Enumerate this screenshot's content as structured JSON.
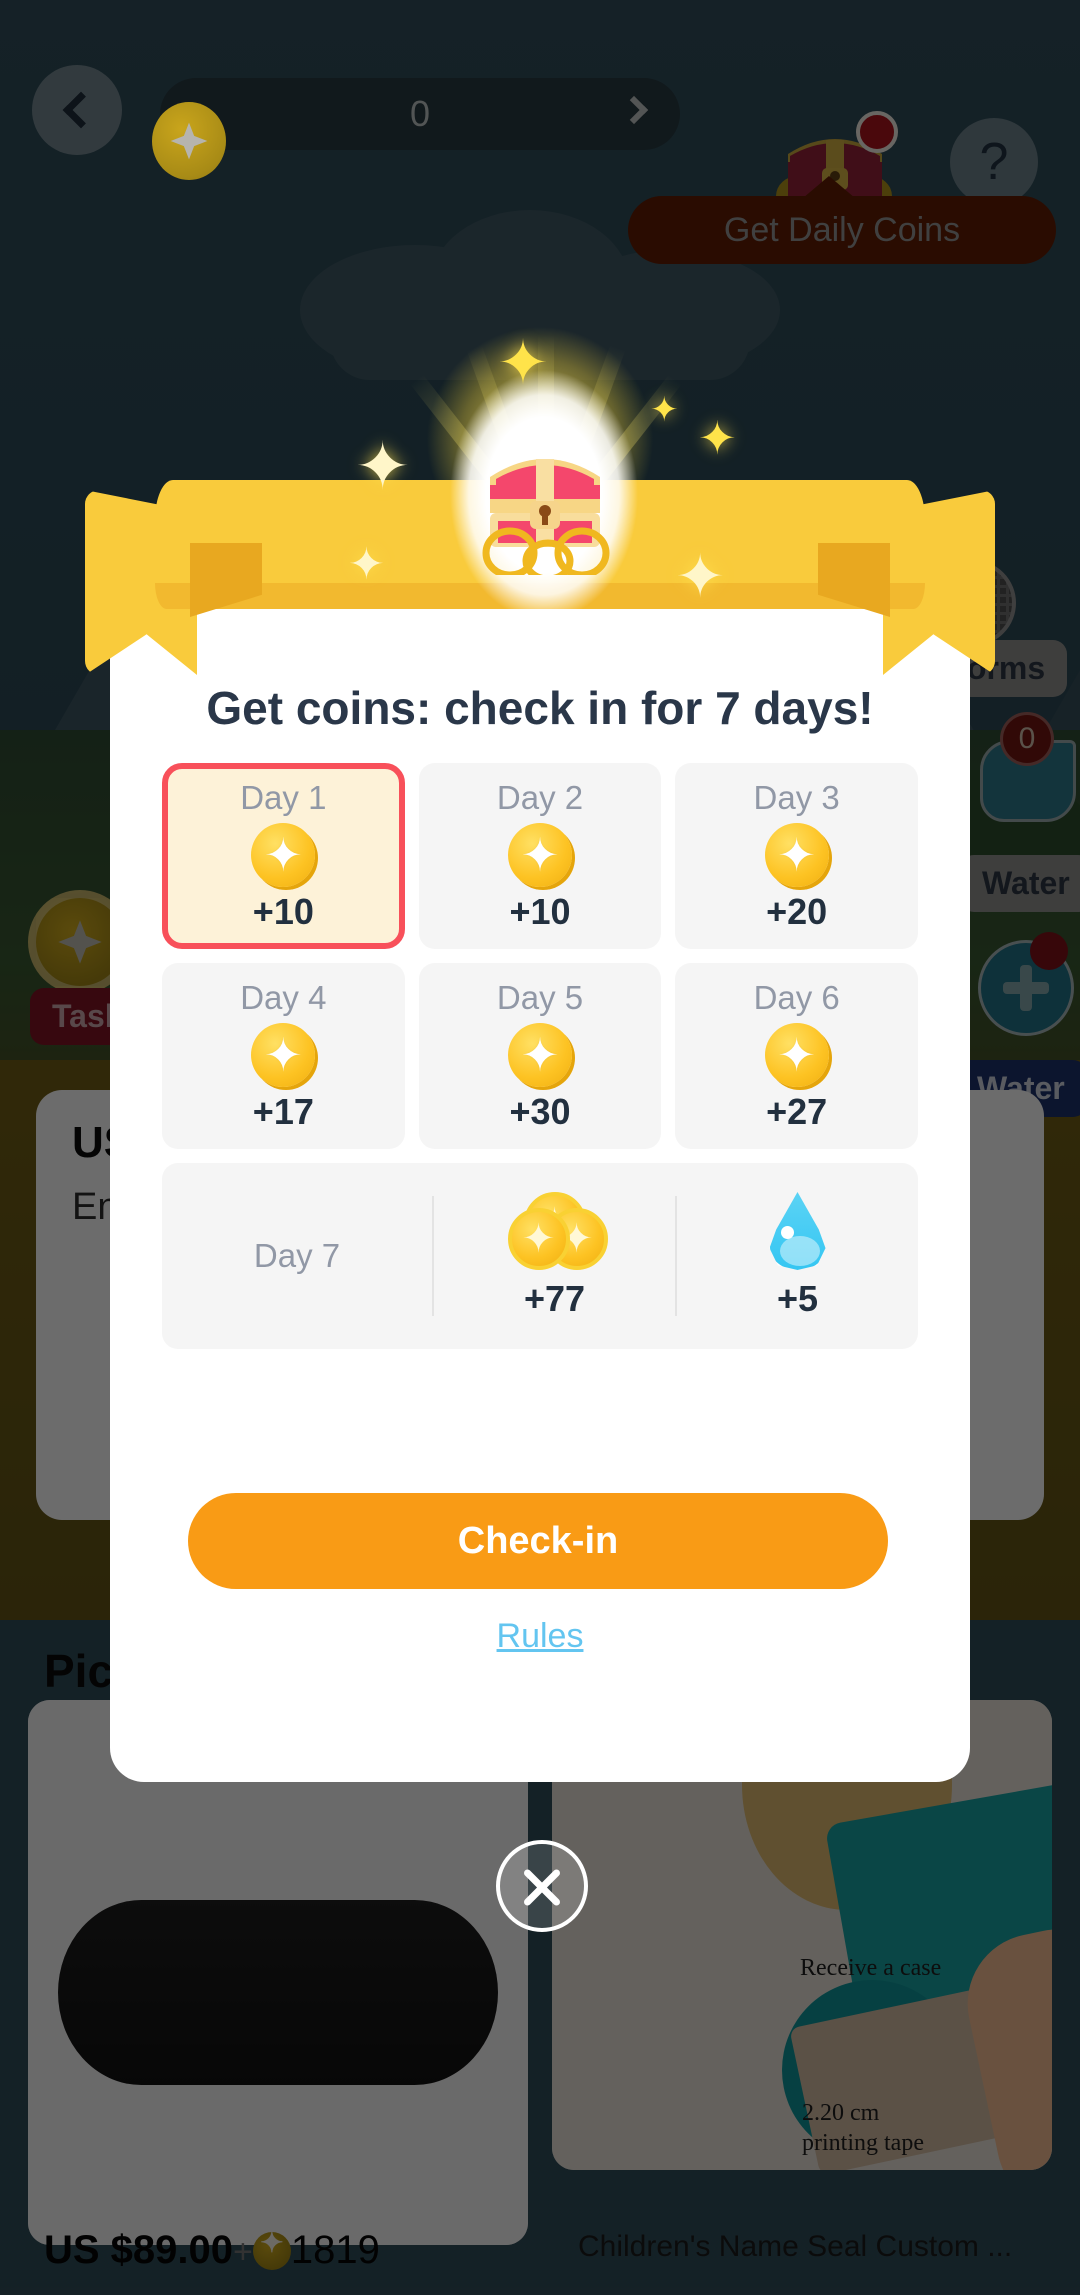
{
  "topbar": {
    "back_icon": "chevron-left-icon",
    "coin_icon": "star-coin-icon",
    "coin_value": "0",
    "forward_icon": "chevron-right-icon",
    "chest_icon": "treasure-chest-icon",
    "help_label": "?",
    "tooltip_text": "Get Daily Coins"
  },
  "scene": {
    "chips": [
      {
        "label": "worms"
      },
      {
        "label": "Water"
      },
      {
        "label": "Water"
      },
      {
        "label": "Task"
      }
    ],
    "watercan_badge": "0"
  },
  "behind": {
    "us_title": "US",
    "us_sub": "En",
    "pick_title": "Pick",
    "products": [
      {
        "name": "",
        "price": "US $89.00",
        "plus": "+",
        "coins": "1819"
      },
      {
        "name": "Children's Name Seal Custom ...",
        "price": "",
        "plus": "",
        "coins": ""
      }
    ],
    "seal_texts": [
      "Receive a case",
      "2.20 cm",
      "printing tape"
    ]
  },
  "modal": {
    "title": "Get coins: check in for 7 days!",
    "header_icon": "treasure-chest-icon",
    "ribbon_icon": "ribbon-banner-icon",
    "days": [
      {
        "label": "Day 1",
        "amount": "+10",
        "icon": "star-coin-icon",
        "active": true
      },
      {
        "label": "Day 2",
        "amount": "+10",
        "icon": "star-coin-icon",
        "active": false
      },
      {
        "label": "Day 3",
        "amount": "+20",
        "icon": "star-coin-icon",
        "active": false
      },
      {
        "label": "Day 4",
        "amount": "+17",
        "icon": "star-coin-icon",
        "active": false
      },
      {
        "label": "Day 5",
        "amount": "+30",
        "icon": "star-coin-icon",
        "active": false
      },
      {
        "label": "Day 6",
        "amount": "+27",
        "icon": "star-coin-icon",
        "active": false
      }
    ],
    "day7": {
      "label": "Day 7",
      "coin_amount": "+77",
      "coin_icon": "coin-stack-icon",
      "water_amount": "+5",
      "water_icon": "water-drop-icon"
    },
    "cta_label": "Check-in",
    "rules_label": "Rules",
    "close_icon": "close-icon"
  },
  "colors": {
    "accent_orange": "#f99b15",
    "active_border": "#f8505a",
    "active_bg": "#fdf2d8",
    "link_blue": "#63c5f0",
    "coin_gold": "#fdc323",
    "water_blue": "#35c6f2",
    "title_navy": "#2a3749",
    "day_label_grey": "#9198a6"
  }
}
